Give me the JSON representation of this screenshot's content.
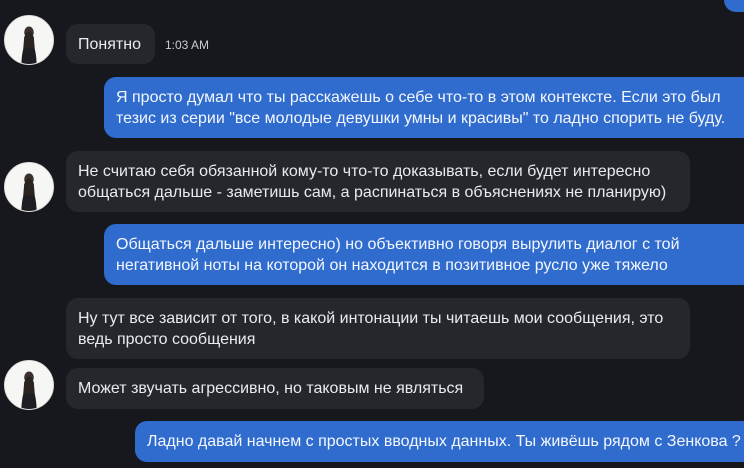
{
  "messages": [
    {
      "direction": "incoming",
      "text_lines": [
        "Понятно"
      ],
      "time": "1:03 AM",
      "show_avatar": true
    },
    {
      "direction": "outgoing",
      "text_lines": [
        "Я просто думал что ты расскажешь о себе что-то в этом контексте. Если это был",
        "тезис из серии \"все молодые девушки умны и красивы\" то ладно спорить не буду."
      ]
    },
    {
      "direction": "incoming",
      "text_lines": [
        "Не считаю себя обязанной кому-то что-то доказывать, если будет интересно",
        "общаться дальше - заметишь сам, а распинаться в объяснениях не планирую)"
      ],
      "show_avatar": true
    },
    {
      "direction": "outgoing",
      "text_lines": [
        "Общаться дальше интересно) но объективно говоря вырулить диалог с той",
        "негативной ноты на которой он находится в позитивное русло уже тяжело"
      ]
    },
    {
      "direction": "incoming",
      "text_lines": [
        "Ну тут все зависит от того, в какой интонации ты читаешь мои сообщения, это",
        "ведь просто сообщения"
      ]
    },
    {
      "direction": "incoming",
      "text_lines": [
        "Может звучать агрессивно, но таковым не являться"
      ],
      "show_avatar": true
    },
    {
      "direction": "outgoing",
      "text_lines": [
        "Ладно давай начнем с простых вводных данных. Ты живёшь рядом с Зенкова ?"
      ]
    }
  ],
  "colors": {
    "background": "#16181d",
    "incoming_bubble": "#25272d",
    "outgoing_bubble": "#2f6ccd",
    "text": "#e9ebef"
  },
  "icons": {
    "avatar": "user-avatar-photo"
  }
}
